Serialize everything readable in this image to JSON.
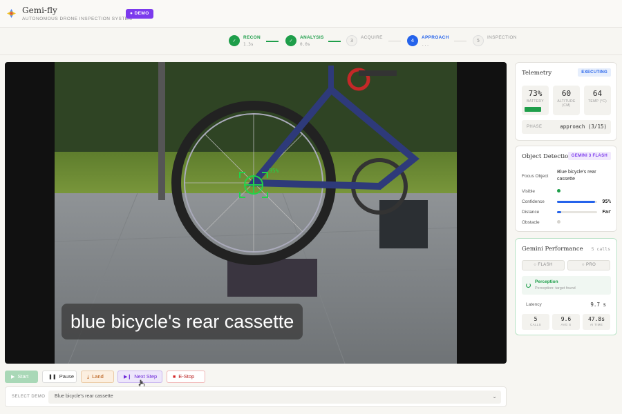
{
  "header": {
    "title": "Gemi-fly",
    "subtitle": "AUTONOMOUS DRONE INSPECTION SYSTEM",
    "badge": "DEMO",
    "badge_color": "#7c3aed"
  },
  "stepper": {
    "steps": [
      {
        "label": "RECON",
        "sub": "1.3s",
        "state": "done",
        "mark": "✓"
      },
      {
        "label": "ANALYSIS",
        "sub": "0.0s",
        "state": "done",
        "mark": "✓"
      },
      {
        "label": "ACQUIRE",
        "sub": "",
        "state": "pending",
        "mark": "3"
      },
      {
        "label": "APPROACH",
        "sub": "...",
        "state": "active",
        "mark": "4"
      },
      {
        "label": "INSPECTION",
        "sub": "",
        "state": "pending",
        "mark": "5"
      }
    ]
  },
  "video": {
    "caption": "blue bicycle's rear cassette",
    "overlay_confidence": "95%"
  },
  "controls": {
    "start": "Start",
    "pause": "Pause",
    "land": "Land",
    "next_step": "Next Step",
    "estop": "E-Stop"
  },
  "select": {
    "label": "SELECT DEMO",
    "value": "Blue bicycle's rear cassette"
  },
  "telemetry": {
    "title": "Telemetry",
    "status": "EXECUTING",
    "battery": {
      "value": "73%",
      "label": "BATTERY"
    },
    "altitude": {
      "value": "60",
      "label": "ALTITUDE (CM)"
    },
    "temp": {
      "value": "64",
      "label": "TEMP (°C)"
    },
    "phase_label": "PHASE",
    "phase_value": "approach (3/15)"
  },
  "detection": {
    "title": "Object Detection",
    "model": "GEMINI 3 FLASH",
    "focus_label": "Focus Object",
    "focus_value": "Blue bicycle's rear cassette",
    "visible_label": "Visible",
    "confidence_label": "Confidence",
    "confidence_value": "95%",
    "confidence_level": 0.95,
    "distance_label": "Distance",
    "distance_value": "Far",
    "distance_level": 0.1,
    "obstacle_label": "Obstacle"
  },
  "performance": {
    "title": "Gemini Performance",
    "calls_count": "5 calls",
    "flash_label": "FLASH",
    "pro_label": "PRO",
    "perception_title": "Perception",
    "perception_sub": "Perception: target found",
    "latency_label": "Latency",
    "latency_value": "9.7 s",
    "calls": {
      "value": "5",
      "label": "CALLS"
    },
    "avg": {
      "value": "9.6",
      "label": "AVG S"
    },
    "ai_time": {
      "value": "47.8s",
      "label": "AI TIME"
    }
  }
}
